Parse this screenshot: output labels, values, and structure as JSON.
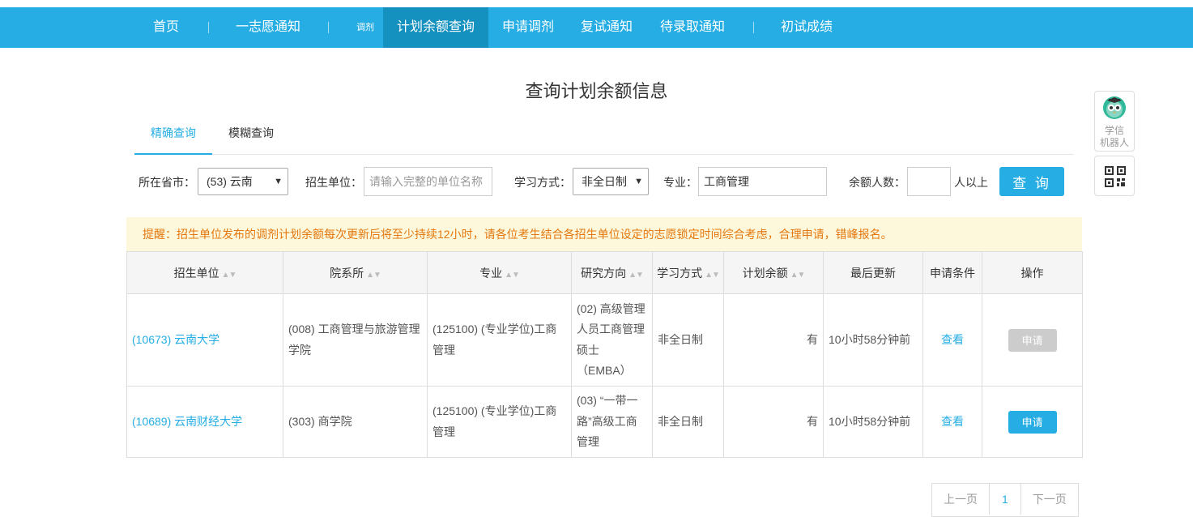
{
  "nav": {
    "items": [
      {
        "label": "首页"
      },
      {
        "label": "一志愿通知"
      },
      {
        "label": "调剂"
      },
      {
        "label": "计划余额查询"
      },
      {
        "label": "申请调剂"
      },
      {
        "label": "复试通知"
      },
      {
        "label": "待录取通知"
      },
      {
        "label": "初试成绩"
      }
    ]
  },
  "page_title": "查询计划余额信息",
  "tabs": [
    {
      "label": "精确查询",
      "active": true
    },
    {
      "label": "模糊查询",
      "active": false
    }
  ],
  "filters": {
    "province_label": "所在省市：",
    "province_value": "(53) 云南",
    "unit_label": "招生单位：",
    "unit_placeholder": "请输入完整的单位名称",
    "mode_label": "学习方式：",
    "mode_value": "非全日制",
    "major_label": "专业：",
    "major_value": "工商管理",
    "remain_label": "余额人数：",
    "remain_value": "",
    "remain_suffix": "人以上",
    "search_label": "查 询"
  },
  "notice": "提醒：招生单位发布的调剂计划余额每次更新后将至少持续12小时，请各位考生结合各招生单位设定的志愿锁定时间综合考虑，合理申请，错峰报名。",
  "table": {
    "headers": [
      "招生单位",
      "院系所",
      "专业",
      "研究方向",
      "学习方式",
      "计划余额",
      "最后更新",
      "申请条件",
      "操作"
    ],
    "rows": [
      {
        "unit": "(10673) 云南大学",
        "dept": "(008) 工商管理与旅游管理学院",
        "major": "(125100) (专业学位)工商管理",
        "direction": "(02) 高级管理人员工商管理硕士（EMBA）",
        "mode": "非全日制",
        "remain": "有",
        "updated": "10小时58分钟前",
        "condition": "查看",
        "action": "申请",
        "action_enabled": false
      },
      {
        "unit": "(10689) 云南财经大学",
        "dept": "(303) 商学院",
        "major": "(125100) (专业学位)工商管理",
        "direction": "(03) “一带一路”高级工商管理",
        "mode": "非全日制",
        "remain": "有",
        "updated": "10小时58分钟前",
        "condition": "查看",
        "action": "申请",
        "action_enabled": true
      }
    ]
  },
  "pagination": {
    "prev": "上一页",
    "current": "1",
    "next": "下一页"
  },
  "side": {
    "robot_label_line1": "学信",
    "robot_label_line2": "机器人"
  },
  "colors": {
    "brand": "#26aee4",
    "nav_active": "#1591c0",
    "notice_bg": "#fdf8dc",
    "notice_text": "#e4770e",
    "disabled_button": "#cccccc"
  }
}
